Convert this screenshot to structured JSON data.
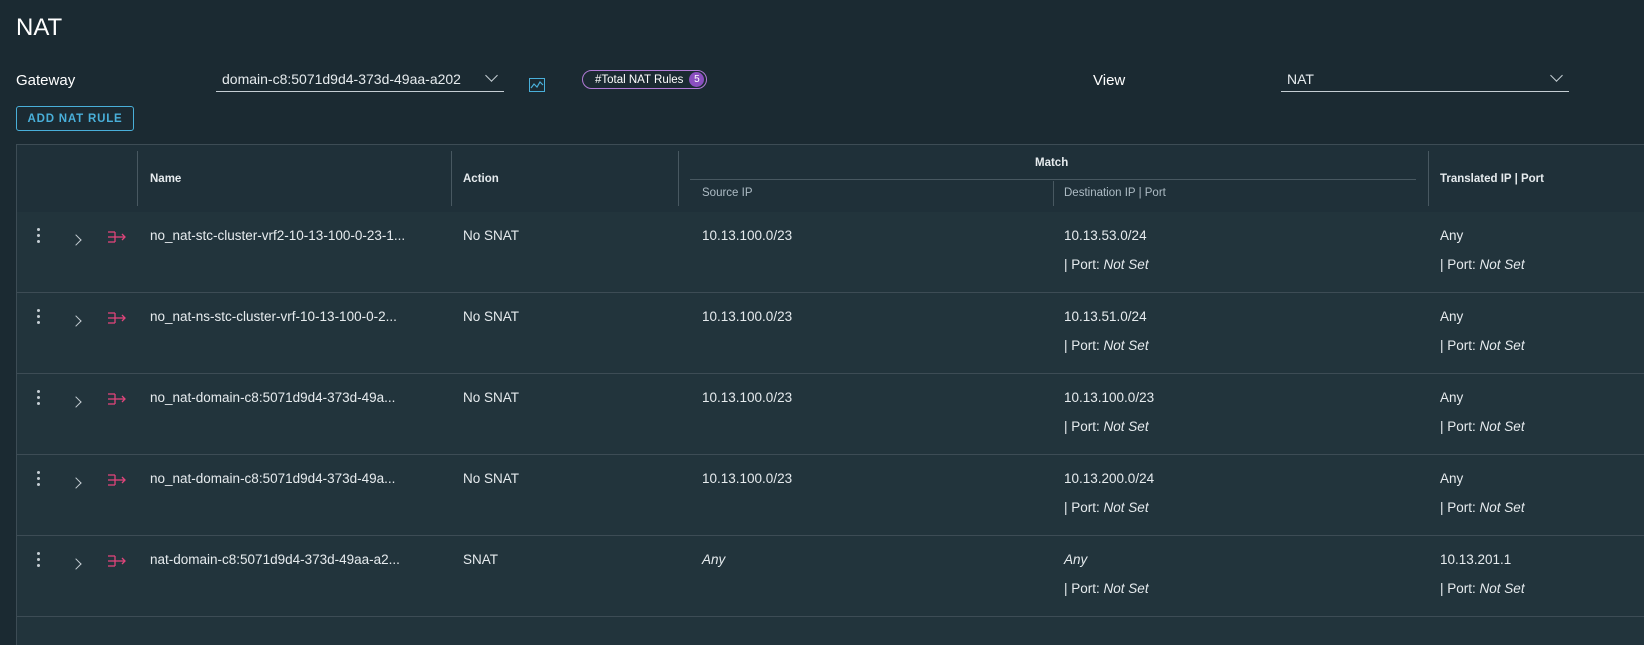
{
  "page": {
    "title": "NAT"
  },
  "gateway": {
    "label": "Gateway",
    "value": "domain-c8:5071d9d4-373d-49aa-a202",
    "chart_icon": "chart-line-icon"
  },
  "total_badge": {
    "label": "#Total NAT Rules",
    "count": "5"
  },
  "view": {
    "label": "View",
    "value": "NAT"
  },
  "add_button": {
    "label": "ADD NAT RULE"
  },
  "table": {
    "headers": {
      "name": "Name",
      "action": "Action",
      "match": "Match",
      "source_ip": "Source IP",
      "destination": "Destination IP | Port",
      "translated": "Translated IP | Port"
    },
    "port_prefix": "| Port:",
    "rows": [
      {
        "name": "no_nat-stc-cluster-vrf2-10-13-100-0-23-1...",
        "action": "No SNAT",
        "source": "10.13.100.0/23",
        "destination": "10.13.53.0/24",
        "dest_port": "Not Set",
        "translated": "Any",
        "trans_port": "Not Set"
      },
      {
        "name": "no_nat-ns-stc-cluster-vrf-10-13-100-0-2...",
        "action": "No SNAT",
        "source": "10.13.100.0/23",
        "destination": "10.13.51.0/24",
        "dest_port": "Not Set",
        "translated": "Any",
        "trans_port": "Not Set"
      },
      {
        "name": "no_nat-domain-c8:5071d9d4-373d-49a...",
        "action": "No SNAT",
        "source": "10.13.100.0/23",
        "destination": "10.13.100.0/23",
        "dest_port": "Not Set",
        "translated": "Any",
        "trans_port": "Not Set"
      },
      {
        "name": "no_nat-domain-c8:5071d9d4-373d-49a...",
        "action": "No SNAT",
        "source": "10.13.100.0/23",
        "destination": "10.13.200.0/24",
        "dest_port": "Not Set",
        "translated": "Any",
        "trans_port": "Not Set"
      },
      {
        "name": "nat-domain-c8:5071d9d4-373d-49aa-a2...",
        "action": "SNAT",
        "source": "Any",
        "destination": "Any",
        "dest_port": "Not Set",
        "translated": "10.13.201.1",
        "trans_port": "Not Set"
      }
    ]
  },
  "colors": {
    "background": "#1b2a32",
    "accent": "#49afd9",
    "badge": "#8a4fbf",
    "nat_icon": "#e0457b"
  }
}
